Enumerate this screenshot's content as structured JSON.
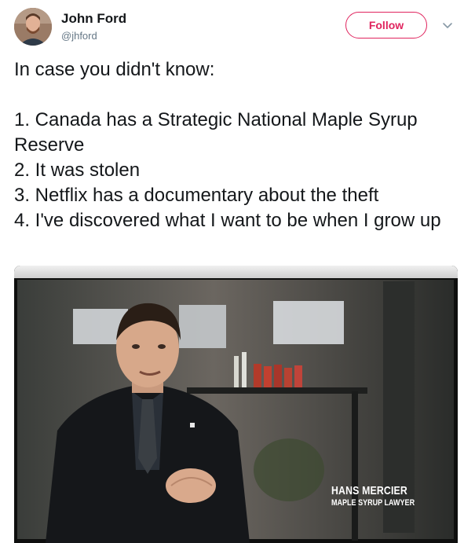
{
  "author": {
    "name": "John Ford",
    "handle": "@jhford",
    "avatar_icon": "user-avatar"
  },
  "actions": {
    "follow_label": "Follow",
    "more_icon": "chevron-down-icon",
    "accent_color": "#e0245e"
  },
  "tweet": {
    "lines": [
      "In case you didn't know:",
      "1. Canada has a Strategic National Maple Syrup Reserve",
      "2. It was stolen",
      "3. Netflix has a documentary about the theft",
      "4. I've discovered what I want to be when I grow up"
    ]
  },
  "media": {
    "caption_name": "HANS MERCIER",
    "caption_role": "MAPLE SYRUP LAWYER"
  }
}
